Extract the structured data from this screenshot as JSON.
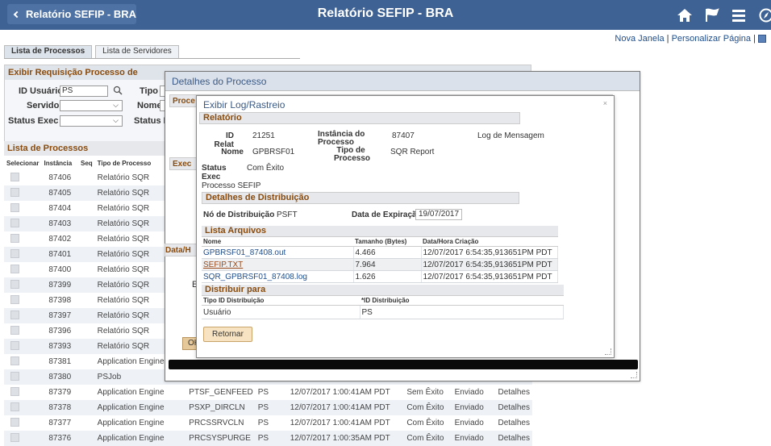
{
  "header": {
    "back_label": "Relatório SEFIP - BRA",
    "title": "Relatório SEFIP - BRA",
    "icons": [
      "home-icon",
      "flag-icon",
      "menu-icon",
      "compass-icon"
    ]
  },
  "under_links": {
    "nova_janela": "Nova Janela",
    "sep": "|",
    "personalizar": "Personalizar Página",
    "sep2": "|"
  },
  "tabs": [
    "Lista de Processos",
    "Lista de Servidores"
  ],
  "exibir": {
    "title": "Exibir Requisição Processo de",
    "id_usuario_label": "ID Usuário",
    "id_usuario_value": "PS",
    "tipo_label": "Tipo",
    "servidor_label": "Servidor",
    "nome_label": "Nome",
    "status_exec_label": "Status Exec",
    "status_di_label": "Status Di"
  },
  "lista": {
    "title": "Lista de Processos",
    "headers": [
      "Selecionar",
      "Instância",
      "Seq",
      "Tipo de Processo"
    ],
    "fragments": {
      "exec": "Exec",
      "data": "Data/H",
      "e": "E",
      "ok": "OK"
    },
    "rows": [
      {
        "inst": "87406",
        "tipo": "Relatório SQR"
      },
      {
        "inst": "87405",
        "tipo": "Relatório SQR"
      },
      {
        "inst": "87404",
        "tipo": "Relatório SQR"
      },
      {
        "inst": "87403",
        "tipo": "Relatório SQR"
      },
      {
        "inst": "87402",
        "tipo": "Relatório SQR"
      },
      {
        "inst": "87401",
        "tipo": "Relatório SQR"
      },
      {
        "inst": "87400",
        "tipo": "Relatório SQR"
      },
      {
        "inst": "87399",
        "tipo": "Relatório SQR"
      },
      {
        "inst": "87398",
        "tipo": "Relatório SQR"
      },
      {
        "inst": "87397",
        "tipo": "Relatório SQR"
      },
      {
        "inst": "87396",
        "tipo": "Relatório SQR"
      },
      {
        "inst": "87393",
        "tipo": "Relatório SQR"
      },
      {
        "inst": "87381",
        "tipo": "Application Engine"
      },
      {
        "inst": "87380",
        "tipo": "PSJob"
      },
      {
        "inst": "87379",
        "tipo": "Application Engine",
        "nome": "PTSF_GENFEED",
        "user": "PS",
        "data": "12/07/2017 1:00:41AM PDT",
        "status": "Sem Êxito",
        "dist": "Enviado",
        "det": "Detalhes"
      },
      {
        "inst": "87378",
        "tipo": "Application Engine",
        "nome": "PSXP_DIRCLN",
        "user": "PS",
        "data": "12/07/2017 1:00:41AM PDT",
        "status": "Com Êxito",
        "dist": "Enviado",
        "det": "Detalhes"
      },
      {
        "inst": "87377",
        "tipo": "Application Engine",
        "nome": "PRCSSRVCLN",
        "user": "PS",
        "data": "12/07/2017 1:00:41AM PDT",
        "status": "Com Êxito",
        "dist": "Enviado",
        "det": "Detalhes"
      },
      {
        "inst": "87376",
        "tipo": "Application Engine",
        "nome": "PRCSYSPURGE",
        "user": "PS",
        "data": "12/07/2017 1:00:35AM PDT",
        "status": "Com Êxito",
        "dist": "Enviado",
        "det": "Detalhes"
      }
    ]
  },
  "detalhes": {
    "title": "Detalhes do Processo",
    "proc_frag": "Proce"
  },
  "log": {
    "title": "Exibir Log/Rastreio",
    "close": "×",
    "relatorio": {
      "title": "Relatório",
      "id_relat_label": "ID Relat",
      "id_relat_value": "21251",
      "instancia_label": "Instância do Processo",
      "instancia_value": "87407",
      "log_link": "Log de Mensagem",
      "nome_label": "Nome",
      "nome_value": "GPBRSF01",
      "tipo_label": "Tipo de Processo",
      "tipo_value": "SQR Report",
      "status_label": "Status Exec",
      "status_value": "Com Êxito",
      "processo_text": "Processo SEFIP"
    },
    "distribuicao": {
      "title": "Detalhes de Distribuição",
      "no_label": "Nó de Distribuição",
      "no_value": "PSFT",
      "exp_label": "Data de Expiração",
      "exp_value": "19/07/2017"
    },
    "arquivos": {
      "title": "Lista Arquivos",
      "headers": [
        "Nome",
        "Tamanho (Bytes)",
        "Data/Hora Criação"
      ],
      "rows": [
        {
          "nome": "GPBRSF01_87408.out",
          "tam": "4.466",
          "data": "12/07/2017  6:54:35,913651PM PDT"
        },
        {
          "nome": "SEFIP.TXT",
          "tam": "7.964",
          "data": "12/07/2017  6:54:35,913651PM PDT"
        },
        {
          "nome": "SQR_GPBRSF01_87408.log",
          "tam": "1.626",
          "data": "12/07/2017  6:54:35,913651PM PDT"
        }
      ]
    },
    "distribuir": {
      "title": "Distribuir para",
      "headers": [
        "Tipo ID Distribuição",
        "*ID Distribuição"
      ],
      "rows": [
        {
          "tipo": "Usuário",
          "id": "PS"
        }
      ]
    },
    "retornar": "Retornar"
  },
  "colors": {
    "header_bg": "#3e6294",
    "section_title": "#8a4b0c",
    "link": "#1f4e8c"
  }
}
